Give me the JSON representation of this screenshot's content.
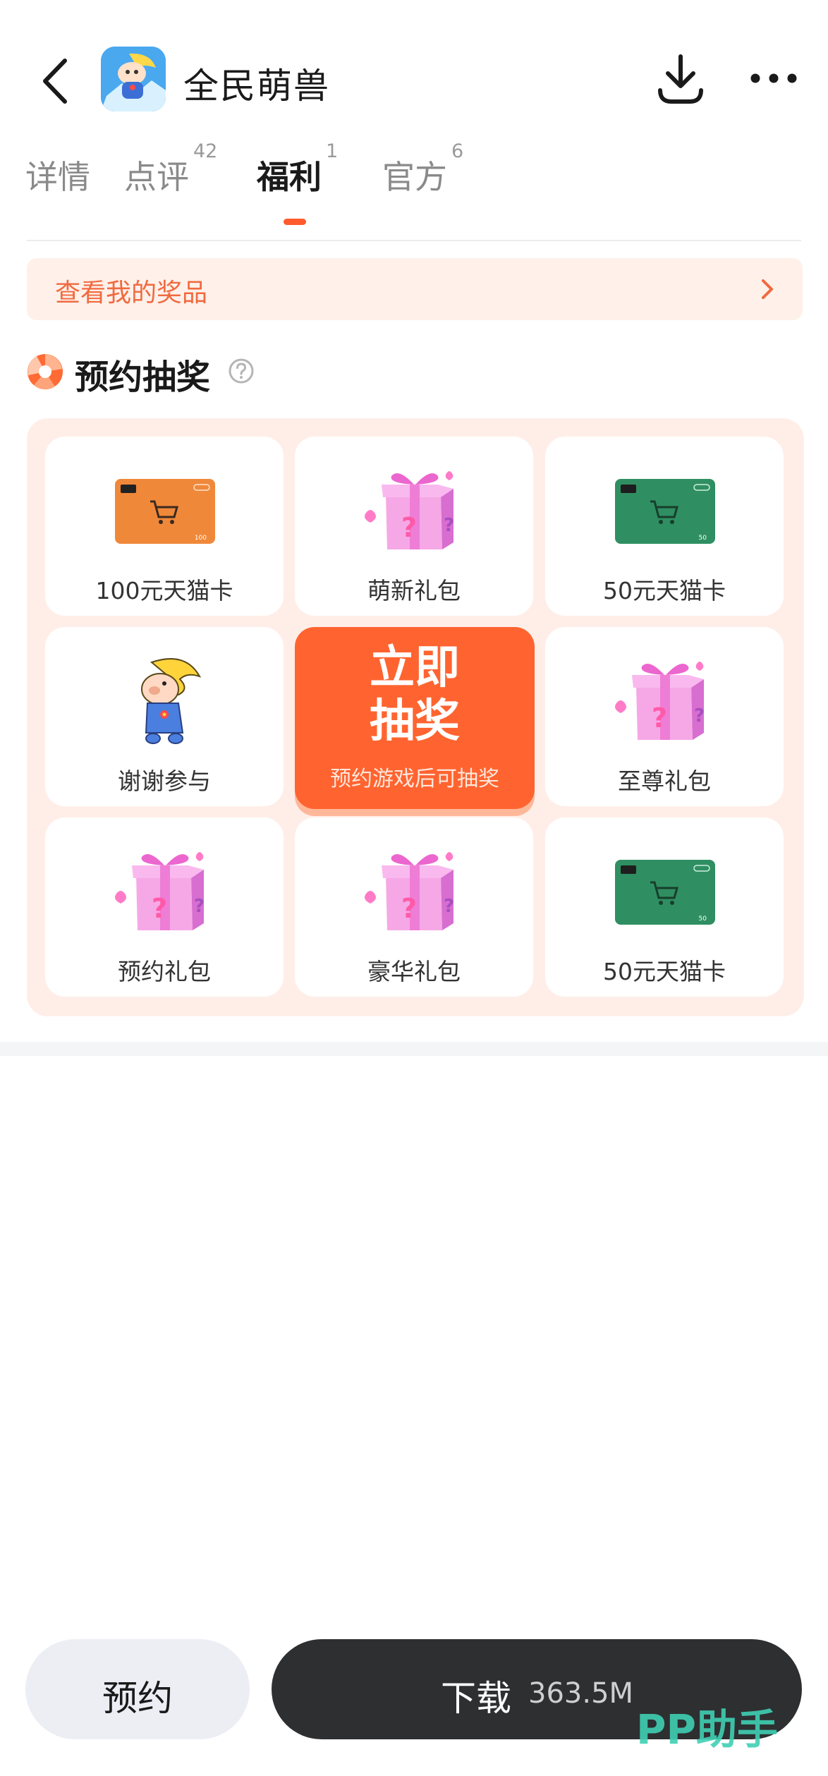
{
  "header": {
    "app_title": "全民萌兽"
  },
  "tabs": [
    {
      "label": "详情",
      "badge": ""
    },
    {
      "label": "点评",
      "badge": "42"
    },
    {
      "label": "福利",
      "badge": "1",
      "active": true
    },
    {
      "label": "官方",
      "badge": "6"
    }
  ],
  "prize_bar": {
    "label": "查看我的奖品"
  },
  "section": {
    "title": "预约抽奖"
  },
  "lottery": {
    "prizes": [
      {
        "label": "100元天猫卡",
        "kind": "orange-card-icon",
        "card_value": "100"
      },
      {
        "label": "萌新礼包",
        "kind": "gift-box-icon"
      },
      {
        "label": "50元天猫卡",
        "kind": "green-card-icon",
        "card_value": "50"
      },
      {
        "label": "谢谢参与",
        "kind": "mascot-icon"
      },
      {
        "label": "至尊礼包",
        "kind": "gift-box-icon"
      },
      {
        "label": "预约礼包",
        "kind": "gift-box-icon"
      },
      {
        "label": "豪华礼包",
        "kind": "gift-box-icon"
      },
      {
        "label": "50元天猫卡",
        "kind": "green-card-icon",
        "card_value": "50"
      }
    ],
    "draw_button": {
      "line1": "立即",
      "line2": "抽奖",
      "sub": "预约游戏后可抽奖"
    }
  },
  "bottom_bar": {
    "reserve_label": "预约",
    "download_label": "下载",
    "download_size": "363.5M"
  },
  "watermark": {
    "text": "PP助手"
  },
  "colors": {
    "accent": "#ff6430",
    "prize_bar_bg": "#fff0ea",
    "lottery_bg": "#ffeee8",
    "download_bg": "#2e2f31",
    "reserve_bg": "#eceef4",
    "watermark": "#3fcfb4"
  }
}
